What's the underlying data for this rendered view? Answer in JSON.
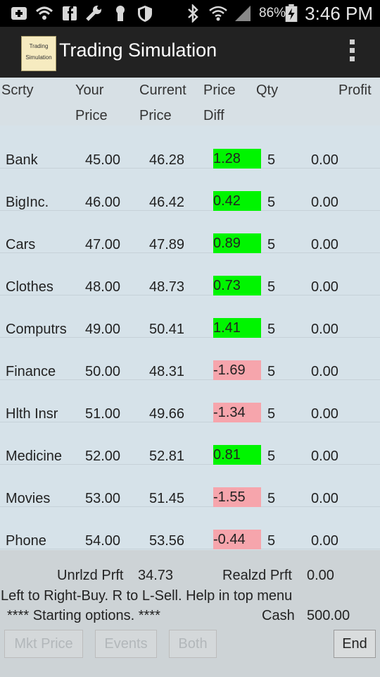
{
  "status_bar": {
    "battery_percent": "86%",
    "time": "3:46 PM",
    "icons": [
      "add-box-icon",
      "wifi-icon",
      "facebook-icon",
      "wrench-icon",
      "keyhole-icon",
      "shield-icon",
      "bluetooth-icon",
      "wifi-signal-icon",
      "cell-signal-icon",
      "battery-charging-icon"
    ]
  },
  "app": {
    "icon_text_line1": "Trading",
    "icon_text_line2": "Simulation",
    "title": "Trading Simulation",
    "menu_icon": "overflow-menu-icon"
  },
  "table": {
    "headers": {
      "scrty": "Scrty",
      "your_price_1": "Your",
      "your_price_2": "Price",
      "current_price_1": "Current",
      "current_price_2": "Price",
      "price_diff_1": "Price",
      "price_diff_2": "Diff",
      "qty": "Qty",
      "profit": "Profit"
    },
    "rows": [
      {
        "name": "Bank",
        "your_price": "45.00",
        "current_price": "46.28",
        "diff": "1.28",
        "qty": "5",
        "profit": "0.00",
        "trend": "up"
      },
      {
        "name": "BigInc.",
        "your_price": "46.00",
        "current_price": "46.42",
        "diff": "0.42",
        "qty": "5",
        "profit": "0.00",
        "trend": "up"
      },
      {
        "name": "Cars",
        "your_price": "47.00",
        "current_price": "47.89",
        "diff": "0.89",
        "qty": "5",
        "profit": "0.00",
        "trend": "up"
      },
      {
        "name": "Clothes",
        "your_price": "48.00",
        "current_price": "48.73",
        "diff": "0.73",
        "qty": "5",
        "profit": "0.00",
        "trend": "up"
      },
      {
        "name": "Computrs",
        "your_price": "49.00",
        "current_price": "50.41",
        "diff": "1.41",
        "qty": "5",
        "profit": "0.00",
        "trend": "up"
      },
      {
        "name": "Finance",
        "your_price": "50.00",
        "current_price": "48.31",
        "diff": "-1.69",
        "qty": "5",
        "profit": "0.00",
        "trend": "down"
      },
      {
        "name": "Hlth Insr",
        "your_price": "51.00",
        "current_price": "49.66",
        "diff": "-1.34",
        "qty": "5",
        "profit": "0.00",
        "trend": "down"
      },
      {
        "name": "Medicine",
        "your_price": "52.00",
        "current_price": "52.81",
        "diff": "0.81",
        "qty": "5",
        "profit": "0.00",
        "trend": "up"
      },
      {
        "name": "Movies",
        "your_price": "53.00",
        "current_price": "51.45",
        "diff": "-1.55",
        "qty": "5",
        "profit": "0.00",
        "trend": "down"
      },
      {
        "name": "Phone",
        "your_price": "54.00",
        "current_price": "53.56",
        "diff": "-0.44",
        "qty": "5",
        "profit": "0.00",
        "trend": "down"
      }
    ]
  },
  "colors": {
    "positive_diff": "#00f500",
    "negative_diff": "#f6a5ac"
  },
  "footer": {
    "unrealized_label": "Unrlzd Prft",
    "unrealized_value": "34.73",
    "realized_label": "Realzd Prft",
    "realized_value": "0.00",
    "help_text": "Left to Right-Buy. R to L-Sell. Help in top menu",
    "status_text": "**** Starting options. ****",
    "cash_label": "Cash",
    "cash_value": "500.00",
    "buttons": {
      "mkt_price": "Mkt Price",
      "events": "Events",
      "both": "Both",
      "end": "End"
    }
  }
}
